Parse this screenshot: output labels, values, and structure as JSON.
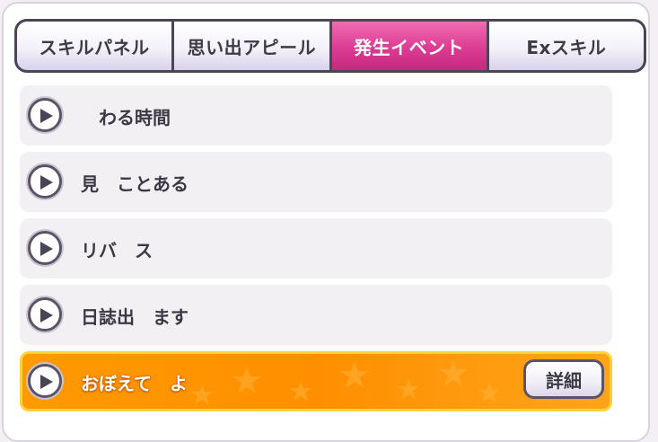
{
  "tabs": [
    {
      "label": "スキルパネル",
      "active": false
    },
    {
      "label": "思い出アピール",
      "active": false
    },
    {
      "label": "発生イベント",
      "active": true
    },
    {
      "label": "Exスキル",
      "active": false
    }
  ],
  "events": [
    {
      "label": "　わる時間"
    },
    {
      "label": "見　ことある"
    },
    {
      "label": "リバ　ス"
    },
    {
      "label": "日誌出　ます"
    },
    {
      "label": "おぼえて　よ",
      "detail_label": "詳細"
    }
  ],
  "colors": {
    "accent": "#dc3c93",
    "highlight": "#ff9000",
    "highlight_border": "#ffd23a"
  }
}
